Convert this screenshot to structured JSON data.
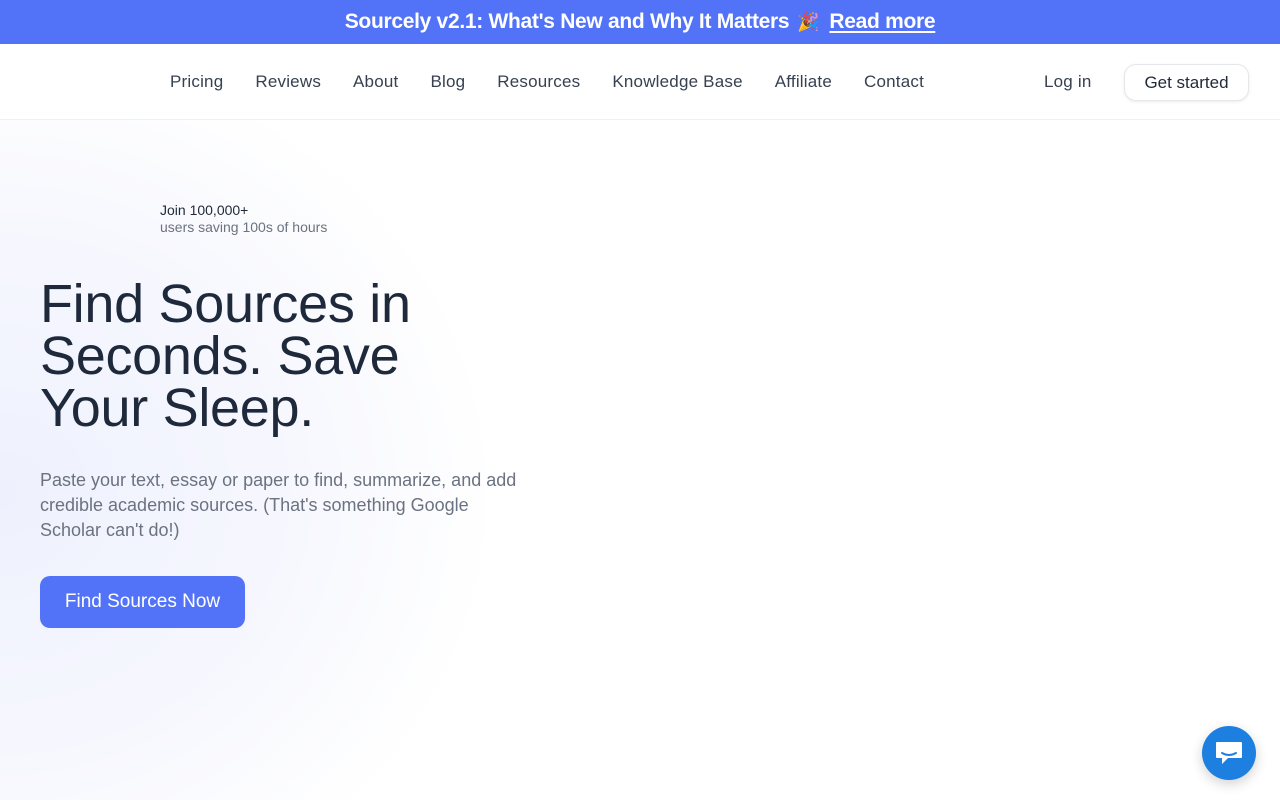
{
  "announcement": {
    "text": "Sourcely v2.1: What's New and Why It Matters",
    "emoji": "🎉",
    "link": "Read more"
  },
  "nav": {
    "links": [
      "Pricing",
      "Reviews",
      "About",
      "Blog",
      "Resources",
      "Knowledge Base",
      "Affiliate",
      "Contact"
    ],
    "login": "Log in",
    "cta": "Get started"
  },
  "hero": {
    "join_line1": "Join 100,000+",
    "join_line2": "users saving 100s of hours",
    "title": "Find Sources in Seconds. Save Your Sleep.",
    "subtitle": "Paste your text, essay or paper to find, summarize, and add credible academic sources. (That's something Google Scholar can't do!)",
    "cta": "Find Sources Now"
  },
  "chat": {
    "icon": "chat-bubble-icon"
  },
  "colors": {
    "brand": "#5273f7",
    "chat": "#1d7fe0",
    "heading": "#1e293b",
    "muted": "#6b7280"
  }
}
